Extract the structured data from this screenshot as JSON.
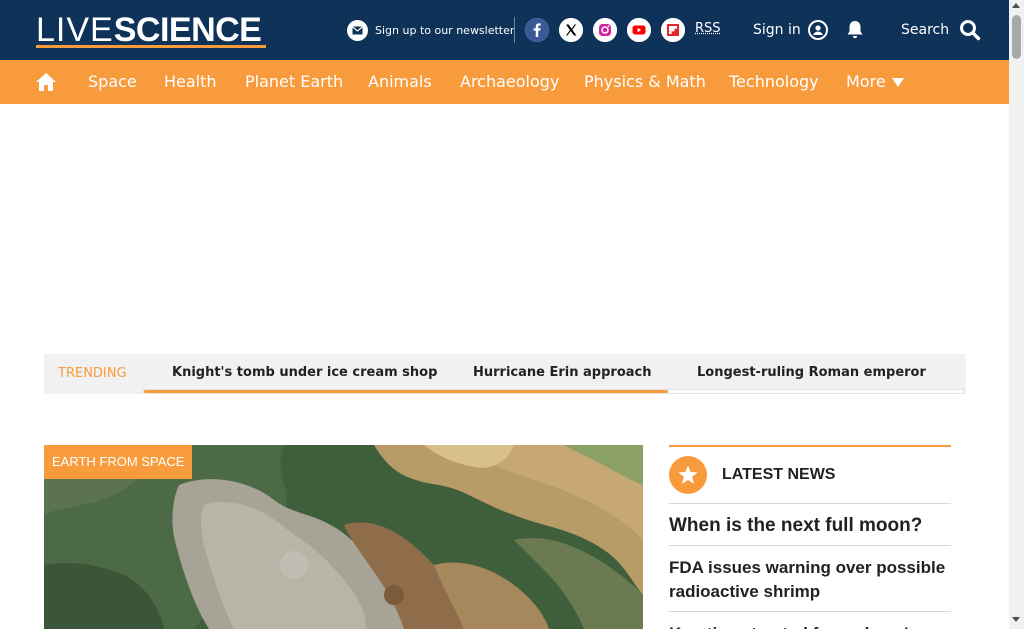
{
  "header": {
    "logo_light": "LIVE",
    "logo_bold": "SCIENCE",
    "newsletter_label": "Sign up to our newsletter",
    "social": [
      {
        "name": "facebook-icon",
        "color": "#3b5998"
      },
      {
        "name": "x-icon",
        "color": "#000000"
      },
      {
        "name": "instagram-icon",
        "color": "#d6249f"
      },
      {
        "name": "youtube-icon",
        "color": "#ff0000"
      },
      {
        "name": "flipboard-icon",
        "color": "#e12828"
      }
    ],
    "rss_label": "RSS",
    "signin_label": "Sign in",
    "search_label": "Search"
  },
  "nav": {
    "items": [
      "Space",
      "Health",
      "Planet Earth",
      "Animals",
      "Archaeology",
      "Physics & Math",
      "Technology"
    ],
    "more_label": "More"
  },
  "trending": {
    "label": "TRENDING",
    "links": [
      "Knight's tomb under ice cream shop",
      "Hurricane Erin approach",
      "Longest-ruling Roman emperor"
    ],
    "scroll_progress": 0.64
  },
  "hero": {
    "tag": "EARTH FROM SPACE"
  },
  "latest_news": {
    "title": "LATEST NEWS",
    "items": [
      "When is the next full moon?",
      "FDA issues warning over possible radioactive shrimp",
      "Keratin extracted from sheep's"
    ]
  },
  "colors": {
    "header_bg": "#0f3258",
    "accent": "#f89b3c",
    "trending_bg": "#f1f1f1",
    "text_dark": "#222222"
  }
}
